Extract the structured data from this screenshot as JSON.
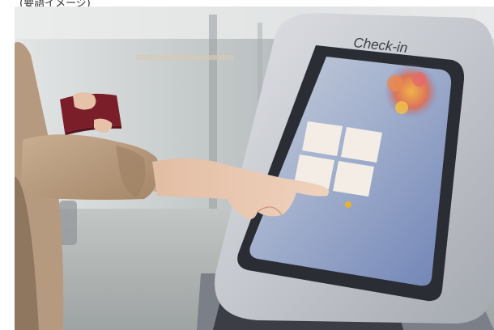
{
  "caption": "(要語イメージ)",
  "kiosk": {
    "label": "Check-in"
  },
  "colors": {
    "kiosk_body": "#c9ccd2",
    "screen": "#8ea3c9",
    "passport": "#7a1f2a",
    "sleeve": "#b89a7e"
  }
}
